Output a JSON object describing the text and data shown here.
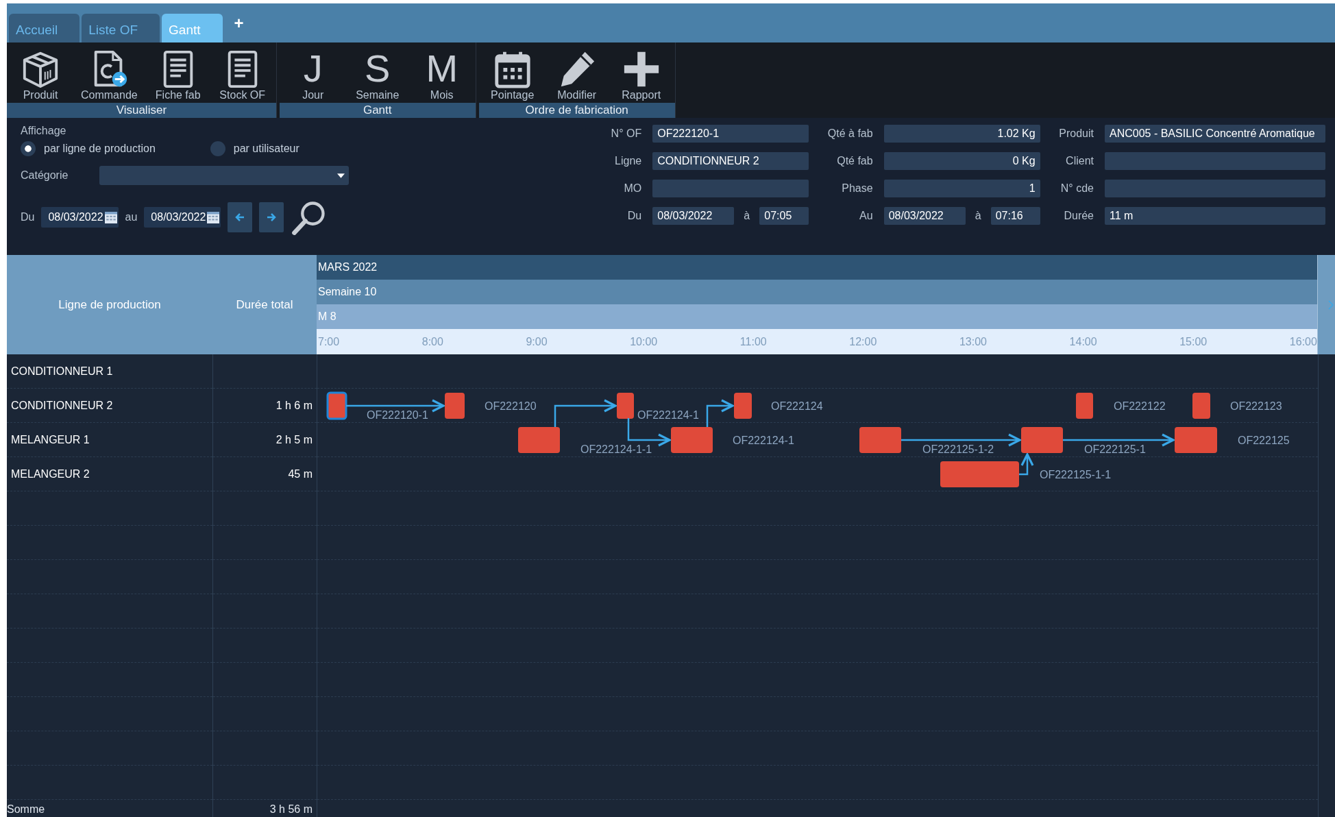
{
  "tabs": [
    {
      "label": "Accueil",
      "selected": false
    },
    {
      "label": "Liste OF",
      "selected": false
    },
    {
      "label": "Gantt",
      "selected": true
    }
  ],
  "new_tab": "+",
  "toolbar": {
    "groups": [
      {
        "label": "Visualiser",
        "buttons": [
          {
            "kind": "box",
            "label": "Produit"
          },
          {
            "kind": "order",
            "label": "Commande"
          },
          {
            "kind": "doc",
            "label": "Fiche fab"
          },
          {
            "kind": "doc",
            "label": "Stock OF"
          }
        ]
      },
      {
        "label": "Gantt",
        "buttons": [
          {
            "kind": "letter",
            "glyph": "J",
            "label": "Jour"
          },
          {
            "kind": "letter",
            "glyph": "S",
            "label": "Semaine"
          },
          {
            "kind": "letter",
            "glyph": "M",
            "label": "Mois"
          }
        ]
      },
      {
        "label": "Ordre de fabrication",
        "buttons": [
          {
            "kind": "calendar",
            "label": "Pointage"
          },
          {
            "kind": "pencil",
            "label": "Modifier"
          },
          {
            "kind": "plus",
            "label": "Rapport"
          }
        ]
      }
    ]
  },
  "filters": {
    "display_label": "Affichage",
    "options": [
      {
        "label": "par ligne de production",
        "selected": true
      },
      {
        "label": "par utilisateur",
        "selected": false
      }
    ],
    "category_label": "Catégorie",
    "from_label": "Du",
    "from": "08/03/2022",
    "to_label": "au",
    "to": "08/03/2022"
  },
  "details": [
    [
      {
        "kind": "text",
        "label": "N° OF",
        "value": "OF222120-1"
      },
      {
        "kind": "number",
        "label": "Qté à fab",
        "value": "1.02 Kg"
      },
      {
        "kind": "text",
        "label": "Produit",
        "value": "ANC005 - BASILIC Concentré Aromatique"
      }
    ],
    [
      {
        "kind": "text",
        "label": "Ligne",
        "value": "CONDITIONNEUR 2"
      },
      {
        "kind": "number",
        "label": "Qté fab",
        "value": "0 Kg"
      },
      {
        "kind": "text",
        "label": "Client"
      }
    ],
    [
      {
        "kind": "text",
        "label": "MO"
      },
      {
        "kind": "number",
        "label": "Phase",
        "value": "1"
      },
      {
        "kind": "text",
        "label": "N° cde"
      }
    ],
    [
      {
        "kind": "datetime",
        "label": "Du",
        "date": "08/03/2022",
        "at": "à",
        "time": "07:05"
      },
      {
        "kind": "datetime",
        "label": "Au",
        "date": "08/03/2022",
        "at": "à",
        "time": "07:16"
      },
      {
        "kind": "text",
        "label": "Durée",
        "value": "11 m"
      }
    ]
  ],
  "gantt": {
    "columns": [
      "Ligne de production",
      "Durée total"
    ],
    "month": "MARS 2022",
    "week": "Semaine 10",
    "day": "M 8",
    "hours": [
      "7:00",
      "8:00",
      "9:00",
      "10:00",
      "11:00",
      "12:00",
      "13:00",
      "14:00",
      "15:00",
      "16:00"
    ],
    "rows": [
      {
        "name": "CONDITIONNEUR 1",
        "tasks": []
      },
      {
        "name": "CONDITIONNEUR 2",
        "total": "1 h 6 m",
        "tasks": [
          {
            "label": "OF222120-1",
            "selected": true
          },
          {
            "label": "OF222120",
            "selected": false
          },
          {
            "label": "OF222124-1",
            "selected": false
          },
          {
            "label": "OF222124",
            "selected": false
          },
          {
            "label": "OF222122",
            "selected": false
          },
          {
            "label": "OF222123",
            "selected": false
          }
        ]
      },
      {
        "name": "MELANGEUR 1",
        "total": "2 h 5 m",
        "tasks": [
          {
            "label": "OF222124-1-1",
            "selected": false
          },
          {
            "label": "OF222124-1",
            "selected": false
          },
          {
            "label": "OF222125-1-2",
            "selected": false
          },
          {
            "label": "OF222125-1",
            "selected": false
          },
          {
            "label": "OF222125",
            "selected": false
          }
        ]
      },
      {
        "name": "MELANGEUR 2",
        "total": "45 m",
        "tasks": [
          {
            "label": "OF222125-1-1",
            "selected": false
          }
        ]
      }
    ],
    "sum_label": "Somme",
    "sum_total": "3 h 56 m"
  }
}
